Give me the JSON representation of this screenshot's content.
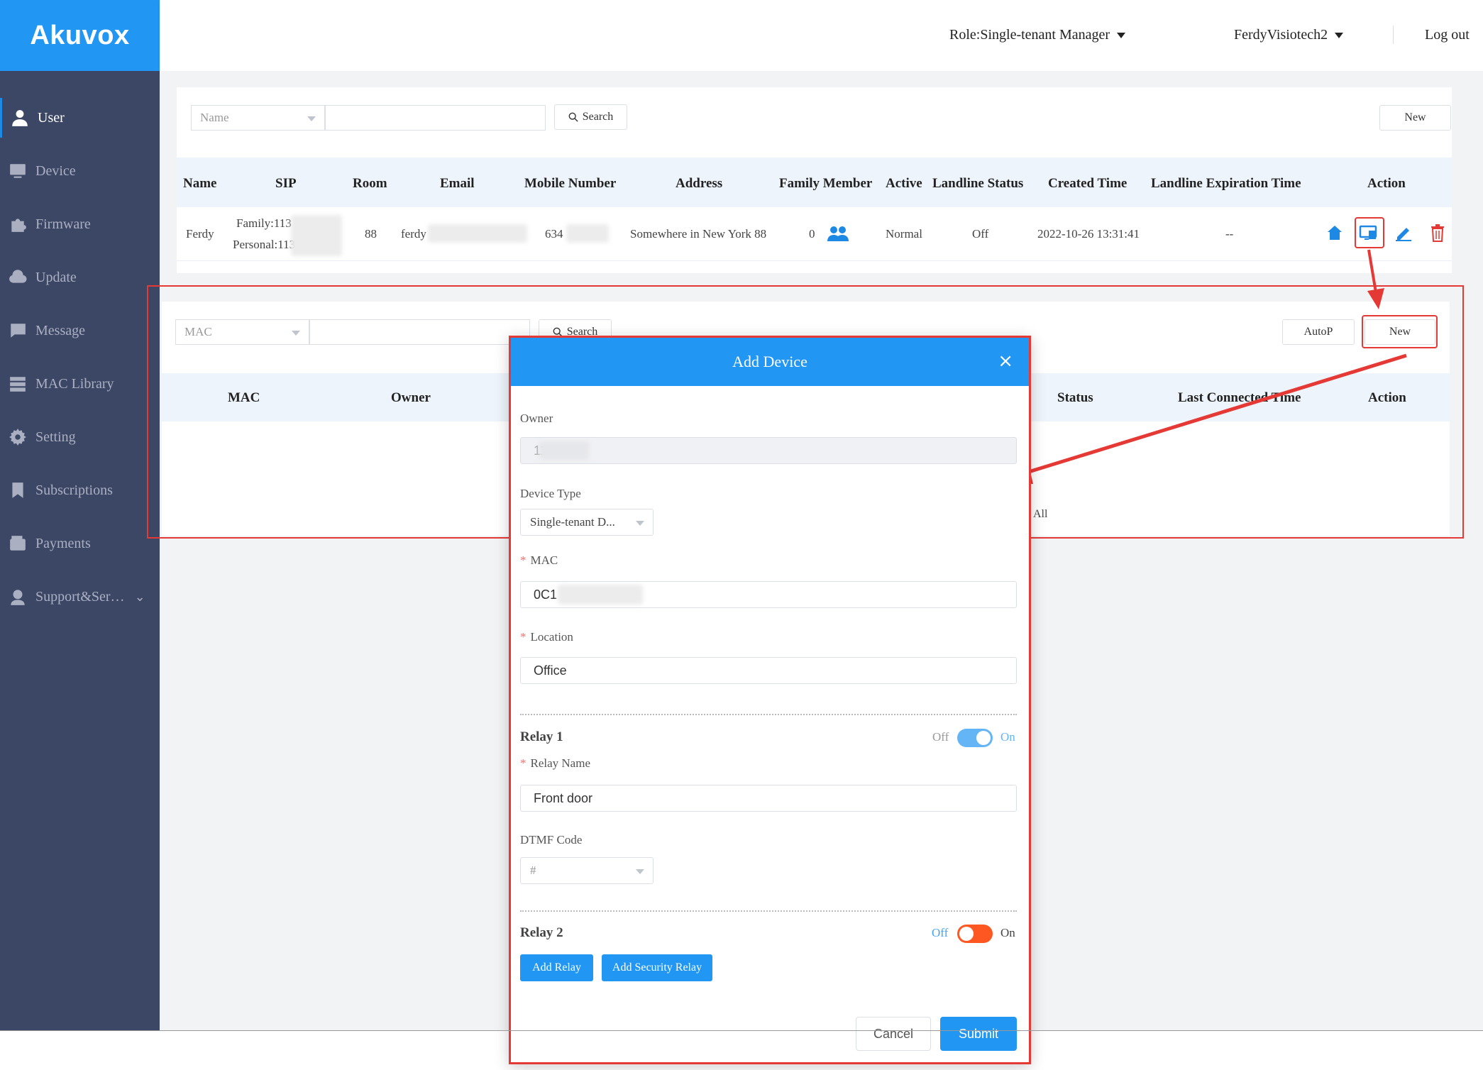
{
  "brand": {
    "logo": "Akuvox",
    "color": "#2196f3"
  },
  "header": {
    "role": "Role:Single-tenant Manager",
    "user": "FerdyVisiotech2",
    "logout": "Log out"
  },
  "sidebar": {
    "items": [
      {
        "label": "User",
        "icon": "user-icon",
        "active": true
      },
      {
        "label": "Device",
        "icon": "device-icon"
      },
      {
        "label": "Firmware",
        "icon": "puzzle-icon"
      },
      {
        "label": "Update",
        "icon": "cloud-upload-icon"
      },
      {
        "label": "Message",
        "icon": "message-icon"
      },
      {
        "label": "MAC Library",
        "icon": "server-icon"
      },
      {
        "label": "Setting",
        "icon": "gear-icon"
      },
      {
        "label": "Subscriptions",
        "icon": "bookmark-icon"
      },
      {
        "label": "Payments",
        "icon": "wallet-icon"
      },
      {
        "label": "Support&Ser…",
        "icon": "headset-icon"
      }
    ]
  },
  "user_panel": {
    "filter_select": "Name",
    "search_label": "Search",
    "new_label": "New",
    "columns": [
      "Name",
      "SIP",
      "Room",
      "Email",
      "Mobile Number",
      "Address",
      "Family Member",
      "Active",
      "Landline Status",
      "Created Time",
      "Landline Expiration Time",
      "Action"
    ],
    "row": {
      "name": "Ferdy",
      "sip_family": "Family:113",
      "sip_personal": "Personal:113",
      "room": "88",
      "email": "ferdy",
      "mobile": "634",
      "address": "Somewhere in New York 88",
      "family_member": "0",
      "active": "Normal",
      "landline_status": "Off",
      "created_time": "2022-10-26 13:31:41",
      "landline_expiration": "--"
    }
  },
  "device_panel": {
    "filter_select": "MAC",
    "search_label": "Search",
    "autop_label": "AutoP",
    "new_label": "New",
    "columns": [
      "MAC",
      "Owner",
      "Status",
      "Last Connected Time",
      "Action"
    ],
    "empty_partial": "All"
  },
  "modal": {
    "title": "Add Device",
    "owner_label": "Owner",
    "owner_value": "11",
    "device_type_label": "Device Type",
    "device_type_value": "Single-tenant D...",
    "mac_label": "MAC",
    "mac_value": "0C1",
    "location_label": "Location",
    "location_value": "Office",
    "relay1": {
      "title": "Relay 1",
      "off": "Off",
      "on": "On",
      "enabled": true,
      "name_label": "Relay Name",
      "name_value": "Front door",
      "dtmf_label": "DTMF Code",
      "dtmf_value": "#"
    },
    "relay2": {
      "title": "Relay 2",
      "off": "Off",
      "on": "On",
      "enabled": false
    },
    "add_relay": "Add Relay",
    "add_security_relay": "Add Security Relay",
    "cancel": "Cancel",
    "submit": "Submit"
  },
  "colors": {
    "accent": "#2196f3",
    "annotation": "#e53935",
    "sidebar": "#3c4766",
    "toggle_off": "#ff5722"
  }
}
